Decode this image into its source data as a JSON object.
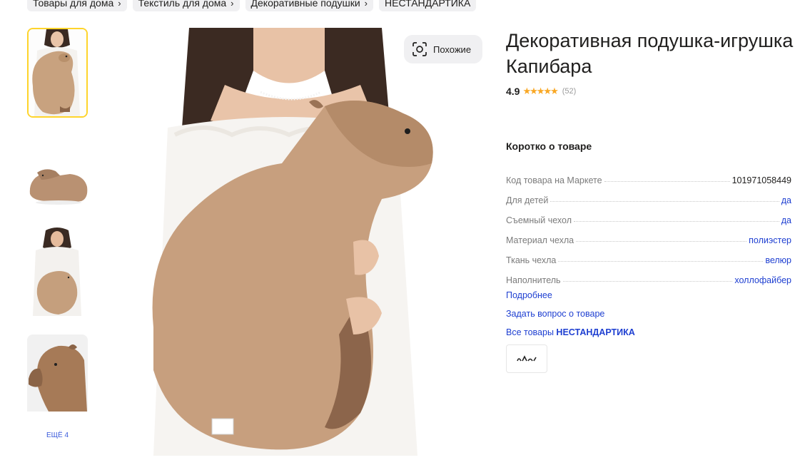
{
  "breadcrumbs": [
    {
      "label": "Товары для дома"
    },
    {
      "label": "Текстиль для дома"
    },
    {
      "label": "Декоративные подушки"
    },
    {
      "label": "НЕСТАНДАРТИКА"
    }
  ],
  "gallery": {
    "more_label": "ЕЩЁ 4",
    "similar_label": "Похожие",
    "similar_icon": "image-search-icon"
  },
  "product": {
    "title": "Декоративная подушка-игрушка Капибара",
    "rating": "4.9",
    "rating_stars": 5,
    "reviews": "(52)"
  },
  "specs": {
    "heading": "Коротко о товаре",
    "rows": [
      {
        "key": "Код товара на Маркете",
        "value": "101971058449"
      },
      {
        "key": "Для детей",
        "value": "да"
      },
      {
        "key": "Съемный чехол",
        "value": "да"
      },
      {
        "key": "Материал чехла",
        "value": "полиэстер"
      },
      {
        "key": "Ткань чехла",
        "value": "велюр"
      },
      {
        "key": "Наполнитель",
        "value": "холлофайбер"
      }
    ]
  },
  "links": {
    "more": "Подробнее",
    "ask": "Задать вопрос о товаре",
    "all_prefix": "Все товары",
    "brand": "НЕСТАНДАРТИКА"
  },
  "colors": {
    "accent": "#fed42b",
    "link": "#1e3fd1",
    "star": "#f9a825"
  }
}
